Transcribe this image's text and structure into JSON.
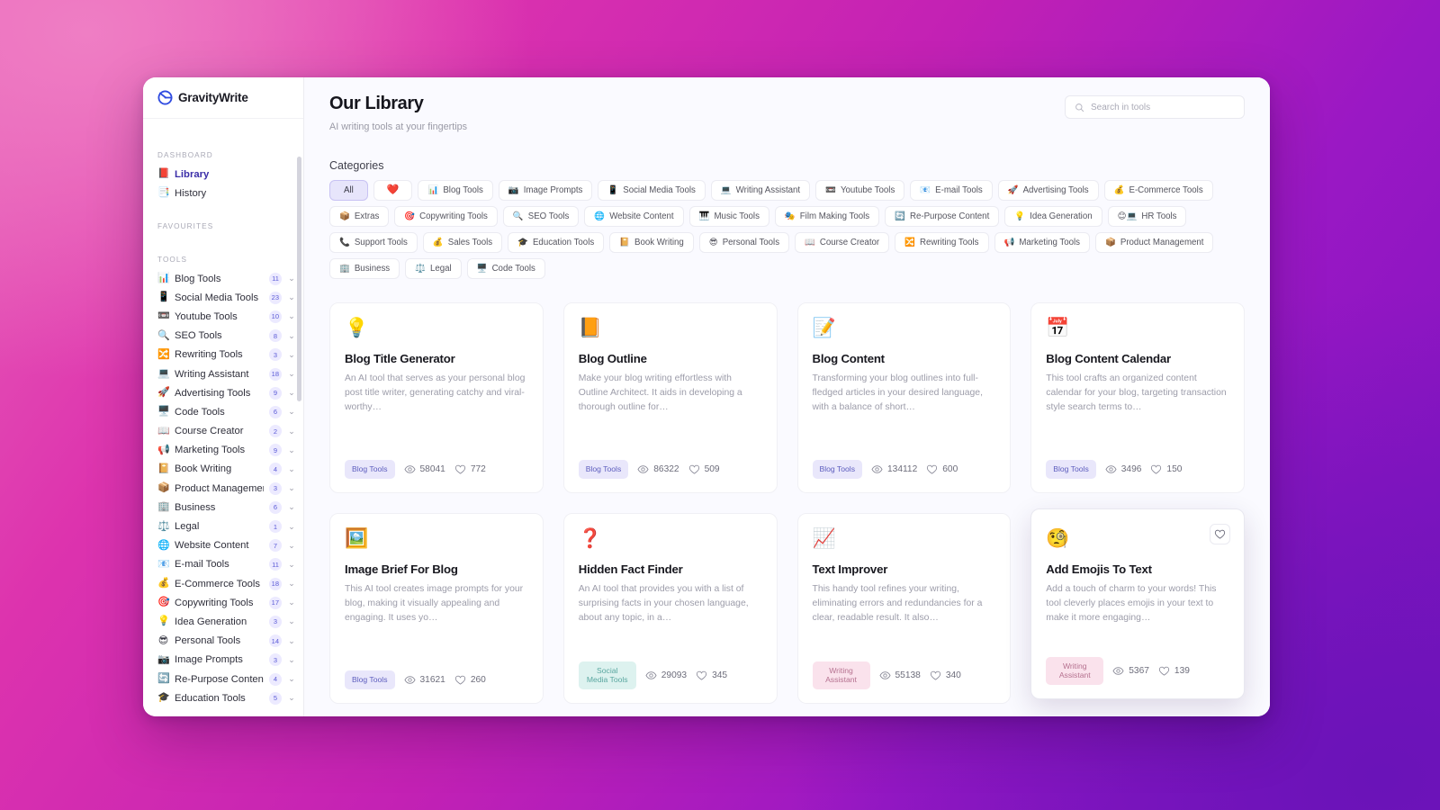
{
  "brand": {
    "name": "GravityWrite"
  },
  "sidebar": {
    "dashboard_caption": "DASHBOARD",
    "favourites_caption": "FAVOURITES",
    "tools_caption": "TOOLS",
    "nav": [
      {
        "label": "Library",
        "icon": "book-icon",
        "emoji": "📕",
        "active": true
      },
      {
        "label": "History",
        "icon": "history-icon",
        "emoji": "📑",
        "active": false
      }
    ],
    "tools": [
      {
        "label": "Blog Tools",
        "emoji": "📊",
        "count": "11"
      },
      {
        "label": "Social Media Tools",
        "emoji": "📱",
        "count": "23"
      },
      {
        "label": "Youtube Tools",
        "emoji": "📼",
        "count": "10"
      },
      {
        "label": "SEO Tools",
        "emoji": "🔍",
        "count": "8"
      },
      {
        "label": "Rewriting Tools",
        "emoji": "🔀",
        "count": "3"
      },
      {
        "label": "Writing Assistant",
        "emoji": "💻",
        "count": "18"
      },
      {
        "label": "Advertising Tools",
        "emoji": "🚀",
        "count": "9"
      },
      {
        "label": "Code Tools",
        "emoji": "🖥️",
        "count": "6"
      },
      {
        "label": "Course Creator",
        "emoji": "📖",
        "count": "2"
      },
      {
        "label": "Marketing Tools",
        "emoji": "📢",
        "count": "9"
      },
      {
        "label": "Book Writing",
        "emoji": "📔",
        "count": "4"
      },
      {
        "label": "Product Management",
        "emoji": "📦",
        "count": "3"
      },
      {
        "label": "Business",
        "emoji": "🏢",
        "count": "6"
      },
      {
        "label": "Legal",
        "emoji": "⚖️",
        "count": "1"
      },
      {
        "label": "Website Content",
        "emoji": "🌐",
        "count": "7"
      },
      {
        "label": "E-mail Tools",
        "emoji": "📧",
        "count": "11"
      },
      {
        "label": "E-Commerce Tools",
        "emoji": "💰",
        "count": "18"
      },
      {
        "label": "Copywriting Tools",
        "emoji": "🎯",
        "count": "17"
      },
      {
        "label": "Idea Generation",
        "emoji": "💡",
        "count": "3"
      },
      {
        "label": "Personal Tools",
        "emoji": "😎",
        "count": "14"
      },
      {
        "label": "Image Prompts",
        "emoji": "📷",
        "count": "3"
      },
      {
        "label": "Re-Purpose Content",
        "emoji": "🔄",
        "count": "4"
      },
      {
        "label": "Education Tools",
        "emoji": "🎓",
        "count": "5"
      }
    ]
  },
  "header": {
    "title": "Our Library",
    "subtitle": "AI writing tools at your fingertips"
  },
  "search": {
    "placeholder": "Search in tools",
    "value": ""
  },
  "categories": {
    "heading": "Categories",
    "chips": [
      {
        "label": "All",
        "emoji": "",
        "selected": true
      },
      {
        "label": "",
        "emoji": "❤️",
        "selected": false,
        "heart": true
      },
      {
        "label": "Blog Tools",
        "emoji": "📊",
        "selected": false
      },
      {
        "label": "Image Prompts",
        "emoji": "📷",
        "selected": false
      },
      {
        "label": "Social Media Tools",
        "emoji": "📱",
        "selected": false
      },
      {
        "label": "Writing Assistant",
        "emoji": "💻",
        "selected": false
      },
      {
        "label": "Youtube Tools",
        "emoji": "📼",
        "selected": false
      },
      {
        "label": "E-mail Tools",
        "emoji": "📧",
        "selected": false
      },
      {
        "label": "Advertising Tools",
        "emoji": "🚀",
        "selected": false
      },
      {
        "label": "E-Commerce Tools",
        "emoji": "💰",
        "selected": false
      },
      {
        "label": "Extras",
        "emoji": "📦",
        "selected": false
      },
      {
        "label": "Copywriting Tools",
        "emoji": "🎯",
        "selected": false
      },
      {
        "label": "SEO Tools",
        "emoji": "🔍",
        "selected": false
      },
      {
        "label": "Website Content",
        "emoji": "🌐",
        "selected": false
      },
      {
        "label": "Music Tools",
        "emoji": "🎹",
        "selected": false
      },
      {
        "label": "Film Making Tools",
        "emoji": "🎭",
        "selected": false
      },
      {
        "label": "Re-Purpose Content",
        "emoji": "🔄",
        "selected": false
      },
      {
        "label": "Idea Generation",
        "emoji": "💡",
        "selected": false
      },
      {
        "label": "HR Tools",
        "emoji": "😊💻",
        "selected": false
      },
      {
        "label": "Support Tools",
        "emoji": "📞",
        "selected": false
      },
      {
        "label": "Sales Tools",
        "emoji": "💰",
        "selected": false
      },
      {
        "label": "Education Tools",
        "emoji": "🎓",
        "selected": false
      },
      {
        "label": "Book Writing",
        "emoji": "📔",
        "selected": false
      },
      {
        "label": "Personal Tools",
        "emoji": "😎",
        "selected": false
      },
      {
        "label": "Course Creator",
        "emoji": "📖",
        "selected": false
      },
      {
        "label": "Rewriting Tools",
        "emoji": "🔀",
        "selected": false
      },
      {
        "label": "Marketing Tools",
        "emoji": "📢",
        "selected": false
      },
      {
        "label": "Product Management",
        "emoji": "📦",
        "selected": false
      },
      {
        "label": "Business",
        "emoji": "🏢",
        "selected": false
      },
      {
        "label": "Legal",
        "emoji": "⚖️",
        "selected": false
      },
      {
        "label": "Code Tools",
        "emoji": "🖥️",
        "selected": false
      }
    ]
  },
  "cards": [
    {
      "emoji": "💡",
      "title": "Blog Title Generator",
      "desc": "An AI tool that serves as your personal blog post title writer, generating catchy and viral-worthy…",
      "tag": "Blog Tools",
      "tag_style": "blog",
      "views": "58041",
      "likes": "772",
      "hovered": false
    },
    {
      "emoji": "📙",
      "title": "Blog Outline",
      "desc": "Make your blog writing effortless with Outline Architect. It aids in developing a thorough outline for…",
      "tag": "Blog Tools",
      "tag_style": "blog",
      "views": "86322",
      "likes": "509",
      "hovered": false
    },
    {
      "emoji": "📝",
      "title": "Blog Content",
      "desc": "Transforming your blog outlines into full-fledged articles in your desired language, with a balance of short…",
      "tag": "Blog Tools",
      "tag_style": "blog",
      "views": "134112",
      "likes": "600",
      "hovered": false
    },
    {
      "emoji": "📅",
      "title": "Blog Content Calendar",
      "desc": "This tool crafts an organized content calendar for your blog, targeting transaction style search terms to…",
      "tag": "Blog Tools",
      "tag_style": "blog",
      "views": "3496",
      "likes": "150",
      "hovered": false
    },
    {
      "emoji": "🖼️",
      "title": "Image Brief For Blog",
      "desc": "This AI tool creates image prompts for your blog, making it visually appealing and engaging. It uses yo…",
      "tag": "Blog Tools",
      "tag_style": "blog",
      "views": "31621",
      "likes": "260",
      "hovered": false
    },
    {
      "emoji": "❓",
      "title": "Hidden Fact Finder",
      "desc": "An AI tool that provides you with a list of surprising facts in your chosen language, about any topic, in a…",
      "tag": "Social Media Tools",
      "tag_style": "social",
      "views": "29093",
      "likes": "345",
      "hovered": false
    },
    {
      "emoji": "📈",
      "title": "Text Improver",
      "desc": "This handy tool refines your writing, eliminating errors and redundancies for a clear, readable result. It also…",
      "tag": "Writing Assistant",
      "tag_style": "writing",
      "views": "55138",
      "likes": "340",
      "hovered": false
    },
    {
      "emoji": "🧐",
      "title": "Add Emojis To Text",
      "desc": "Add a touch of charm to your words! This tool cleverly places emojis in your text to make it more engaging…",
      "tag": "Writing Assistant",
      "tag_style": "writing",
      "views": "5367",
      "likes": "139",
      "hovered": true
    }
  ],
  "colors": {
    "accent_purple": "#7b46e4",
    "active_nav": "#3b2ea8",
    "tag_blog_bg": "#e9e7fb",
    "tag_social_bg": "#ddf2ef",
    "tag_writing_bg": "#fae2ec",
    "heart_pink": "#ef4c82"
  }
}
